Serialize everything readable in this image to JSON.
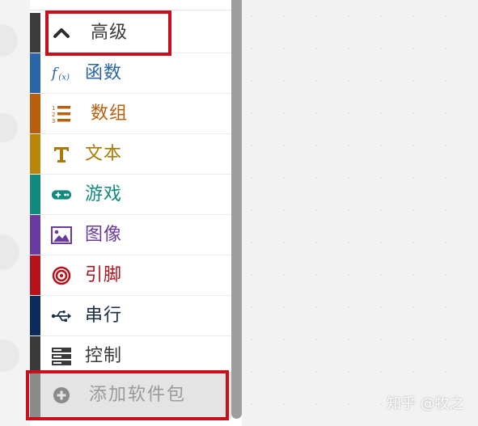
{
  "toolbox": {
    "categories": [
      {
        "id": "advanced",
        "label": "高级",
        "icon": "chevron-up-icon",
        "color": "#3c3c3c",
        "label_color": "#3c3c3c"
      },
      {
        "id": "functions",
        "label": "函数",
        "icon": "function-icon",
        "color": "#2a65a8",
        "label_color": "#2a65a8"
      },
      {
        "id": "arrays",
        "label": "数组",
        "icon": "numbered-list-icon",
        "color": "#b85e0c",
        "label_color": "#b85e0c"
      },
      {
        "id": "text",
        "label": "文本",
        "icon": "text-t-icon",
        "color": "#b8860b",
        "label_color": "#a87a08"
      },
      {
        "id": "game",
        "label": "游戏",
        "icon": "gamepad-icon",
        "color": "#138a80",
        "label_color": "#138a80"
      },
      {
        "id": "images",
        "label": "图像",
        "icon": "image-icon",
        "color": "#6a3aa0",
        "label_color": "#6a3aa0"
      },
      {
        "id": "pins",
        "label": "引脚",
        "icon": "target-icon",
        "color": "#b5121b",
        "label_color": "#b5121b"
      },
      {
        "id": "serial",
        "label": "串行",
        "icon": "usb-icon",
        "color": "#0c2a5c",
        "label_color": "#1c2d4a"
      },
      {
        "id": "control",
        "label": "控制",
        "icon": "server-icon",
        "color": "#3a3a3a",
        "label_color": "#3a3a3a"
      }
    ],
    "add_package": {
      "label": "添加软件包",
      "icon": "plus-circle-icon",
      "color": "#8a8a8a"
    }
  },
  "watermark": "知乎 @牧之"
}
